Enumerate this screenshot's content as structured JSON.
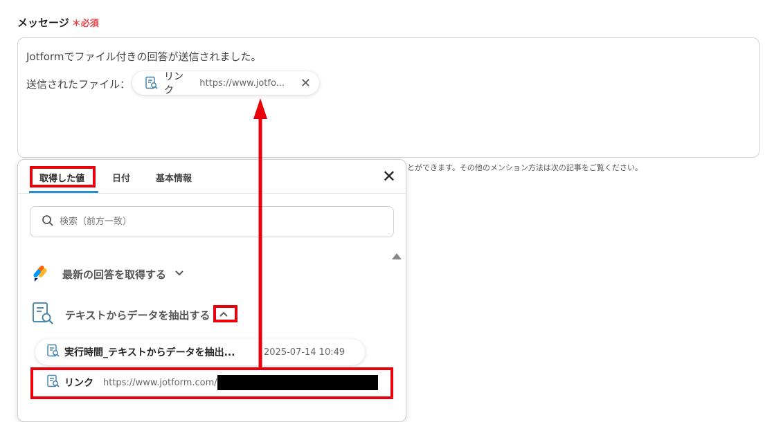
{
  "field": {
    "label": "メッセージ",
    "required_mark": "＊必須"
  },
  "message": {
    "line1": "Jotformでファイル付きの回答が送信されました。",
    "line2_label": "送信されたファイル：",
    "chip": {
      "label": "リンク",
      "value": "https://www.jotfo...",
      "close": "✕"
    }
  },
  "hint": "とができます。その他のメンション方法は次の記事をご覧ください。",
  "panel": {
    "tabs": [
      {
        "label": "取得した値",
        "active": true
      },
      {
        "label": "日付",
        "active": false
      },
      {
        "label": "基本情報",
        "active": false
      }
    ],
    "close": "✕",
    "search_placeholder": "検索（前方一致）",
    "groups": [
      {
        "label": "最新の回答を取得する",
        "chevron": "⌄",
        "icon": "jotform-logo-icon"
      },
      {
        "label": "テキストからデータを抽出する",
        "chevron": "⌃",
        "icon": "document-search-icon"
      }
    ],
    "items": [
      {
        "name": "実行時間_テキストからデータを抽出...",
        "value": "2025-07-14 10:49"
      },
      {
        "name": "リンク",
        "value": "https://www.jotform.com/"
      }
    ]
  },
  "colors": {
    "annotation_red": "#e8000b",
    "required_red": "#e8424b",
    "tab_underline": "#2a8fd0",
    "icon_blue": "#3b7ea8"
  }
}
